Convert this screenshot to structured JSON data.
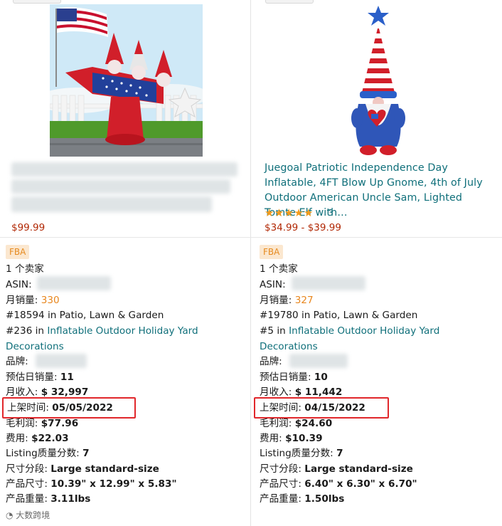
{
  "left": {
    "price": "$99.99",
    "fba_label": "FBA",
    "sellers": "1 个卖家",
    "asin_label": "ASIN:",
    "monthly_sales_label": "月销量:",
    "monthly_sales_value": "330",
    "rank_main": "#18594 in Patio, Lawn & Garden",
    "rank_sub_prefix": "#236 in",
    "rank_sub_link_line1": "Inflatable Outdoor Holiday Yard",
    "rank_sub_link_line2": "Decorations",
    "brand_label": "品牌:",
    "daily_sales_label": "预估日销量:",
    "daily_sales_value": "11",
    "monthly_revenue_label": "月收入:",
    "monthly_revenue_value": "$ 32,997",
    "listed_label": "上架时间:",
    "listed_value": "05/05/2022",
    "gross_profit_label": "毛利润:",
    "gross_profit_value": "$77.96",
    "fee_label": "费用:",
    "fee_value": "$22.03",
    "listing_score_label": "Listing质量分数:",
    "listing_score_value": "7",
    "size_tier_label": "尺寸分段:",
    "size_tier_value": "Large standard-size",
    "dimensions_label": "产品尺寸:",
    "dimensions_value": "10.39\" x 12.99\" x 5.83\"",
    "weight_label": "产品重量:",
    "weight_value": "3.11lbs"
  },
  "right": {
    "title": "Juegoal Patriotic Independence Day Inflatable, 4FT Blow Up Gnome, 4th of July Outdoor American Uncle Sam, Lighted Tomte Elf with…",
    "stars": "★★★★★",
    "review_count": "3",
    "price": "$34.99 - $39.99",
    "fba_label": "FBA",
    "sellers": "1 个卖家",
    "asin_label": "ASIN:",
    "monthly_sales_label": "月销量:",
    "monthly_sales_value": "327",
    "rank_main": "#19780 in Patio, Lawn & Garden",
    "rank_sub_prefix": "#5 in",
    "rank_sub_link_line1": "Inflatable Outdoor Holiday Yard",
    "rank_sub_link_line2": "Decorations",
    "brand_label": "品牌:",
    "daily_sales_label": "预估日销量:",
    "daily_sales_value": "10",
    "monthly_revenue_label": "月收入:",
    "monthly_revenue_value": "$ 11,442",
    "listed_label": "上架时间:",
    "listed_value": "04/15/2022",
    "gross_profit_label": "毛利润:",
    "gross_profit_value": "$24.60",
    "fee_label": "费用:",
    "fee_value": "$10.39",
    "listing_score_label": "Listing质量分数:",
    "listing_score_value": "7",
    "size_tier_label": "尺寸分段:",
    "size_tier_value": "Large standard-size",
    "dimensions_label": "产品尺寸:",
    "dimensions_value": "6.40\" x 6.30\" x 6.70\"",
    "weight_label": "产品重量:",
    "weight_value": "1.50lbs"
  },
  "watermark": "大数跨境",
  "colors": {
    "link": "#0f6f7a",
    "price": "#b12704",
    "sales": "#e8871e",
    "fba_bg": "#fbe7cf",
    "highlight_box": "#e1272b",
    "stars": "#f39b1b"
  }
}
